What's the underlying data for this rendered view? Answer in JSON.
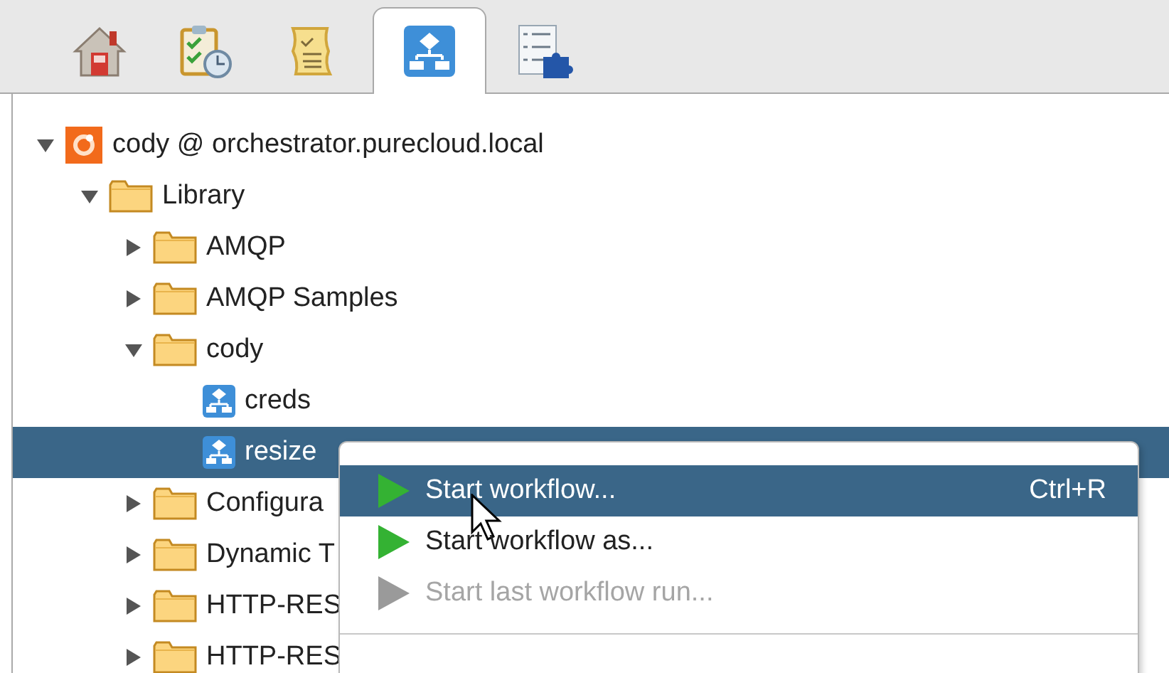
{
  "tabs": [
    {
      "selected": false
    },
    {
      "selected": false
    },
    {
      "selected": false
    },
    {
      "selected": true
    },
    {
      "selected": false
    }
  ],
  "tree": [
    {
      "label": "cody @ orchestrator.purecloud.local",
      "kind": "server",
      "expanded": true,
      "selected": false,
      "children": [
        {
          "label": "Library",
          "kind": "folder",
          "expanded": true,
          "selected": false,
          "children": [
            {
              "label": "AMQP",
              "kind": "folder",
              "expanded": false,
              "selected": false
            },
            {
              "label": "AMQP Samples",
              "kind": "folder",
              "expanded": false,
              "selected": false
            },
            {
              "label": "cody",
              "kind": "folder",
              "expanded": true,
              "selected": false,
              "children": [
                {
                  "label": "creds",
                  "kind": "workflow",
                  "selected": false
                },
                {
                  "label": "resize",
                  "kind": "workflow",
                  "selected": true
                }
              ]
            },
            {
              "label": "Configura",
              "kind": "folder",
              "expanded": false,
              "selected": false
            },
            {
              "label": "Dynamic T",
              "kind": "folder",
              "expanded": false,
              "selected": false
            },
            {
              "label": "HTTP-RES",
              "kind": "folder",
              "expanded": false,
              "selected": false
            },
            {
              "label": "HTTP-RES",
              "kind": "folder",
              "expanded": false,
              "selected": false
            }
          ]
        }
      ]
    }
  ],
  "context_menu": {
    "items": [
      {
        "label": "Start workflow...",
        "shortcut": "Ctrl+R",
        "selected": true,
        "disabled": false
      },
      {
        "label": "Start workflow as...",
        "selected": false,
        "disabled": false
      },
      {
        "label": "Start last workflow run...",
        "selected": false,
        "disabled": true
      }
    ]
  }
}
